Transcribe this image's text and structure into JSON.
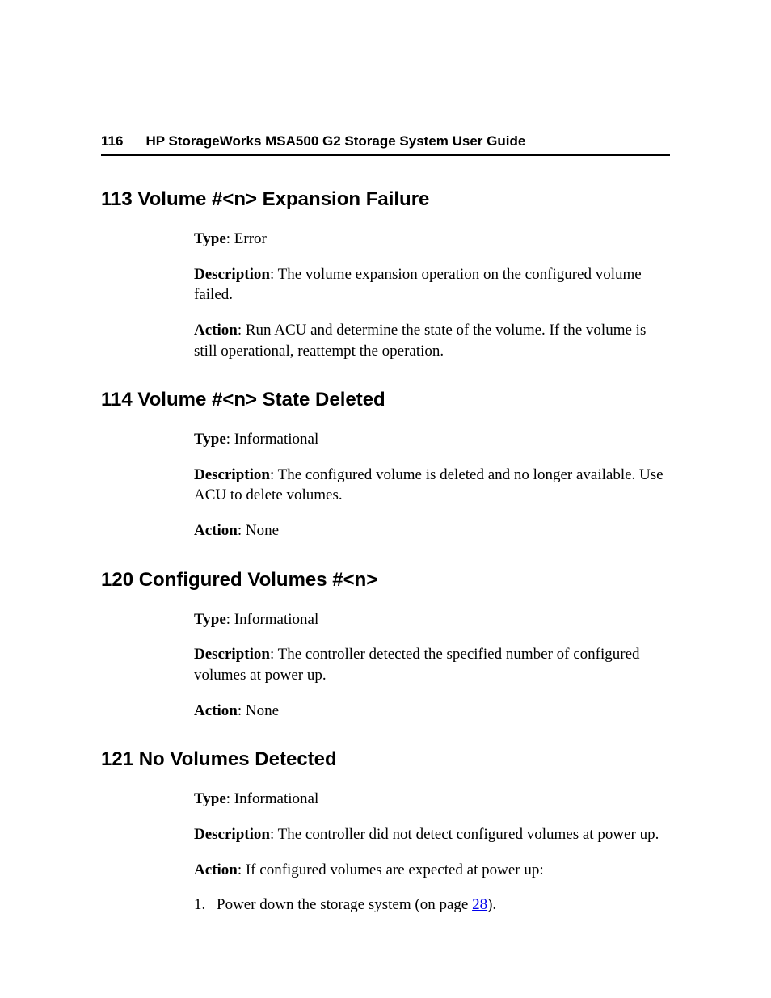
{
  "header": {
    "page_number": "116",
    "doc_title": "HP StorageWorks MSA500 G2 Storage System User Guide"
  },
  "labels": {
    "type": "Type",
    "description": "Description",
    "action": "Action"
  },
  "sections": [
    {
      "heading": "113 Volume #<n> Expansion Failure",
      "type": "Error",
      "description": "The volume expansion operation on the configured volume failed.",
      "action": "Run ACU and determine the state of the volume. If the volume is still operational, reattempt the operation."
    },
    {
      "heading": "114 Volume #<n> State Deleted",
      "type": "Informational",
      "description": "The configured volume is deleted and no longer available. Use ACU to delete volumes.",
      "action": "None"
    },
    {
      "heading": "120 Configured Volumes #<n>",
      "type": "Informational",
      "description": "The controller detected the specified number of configured volumes at power up.",
      "action": "None"
    },
    {
      "heading": "121 No Volumes Detected",
      "type": "Informational",
      "description": "The controller did not detect configured volumes at power up.",
      "action": "If configured volumes are expected at power up:",
      "list": {
        "num": "1.",
        "pre": "Power down the storage system (on page ",
        "link": "28",
        "post": ")."
      }
    }
  ]
}
